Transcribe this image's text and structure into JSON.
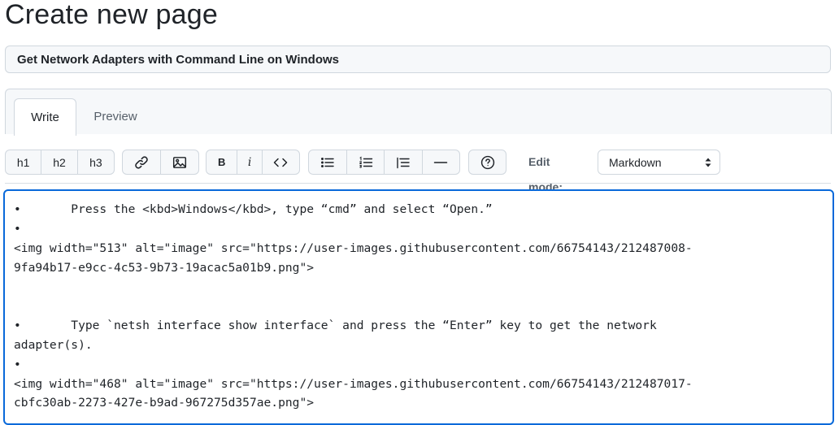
{
  "page": {
    "title": "Create new page"
  },
  "title_input": {
    "value": "Get Network Adapters with Command Line on Windows"
  },
  "tabs": [
    {
      "label": "Write",
      "active": true
    },
    {
      "label": "Preview",
      "active": false
    }
  ],
  "toolbar": {
    "h1_label": "h1",
    "h2_label": "h2",
    "h3_label": "h3",
    "link_icon": "link-icon",
    "image_icon": "image-icon",
    "bold_label": "B",
    "italic_label": "i",
    "code_icon": "code-icon",
    "unordered_list_icon": "unordered-list-icon",
    "ordered_list_icon": "ordered-list-icon",
    "task_list_icon": "task-list-icon",
    "horizontal_rule_icon": "horizontal-rule-icon",
    "help_icon": "question-icon",
    "edit_mode_label": "Edit mode:",
    "edit_mode_value": "Markdown"
  },
  "editor": {
    "content": "•       Press the <kbd>Windows</kbd>, type “cmd” and select “Open.”\n•\n<img width=\"513\" alt=\"image\" src=\"https://user-images.githubusercontent.com/66754143/212487008-\n9fa94b17-e9cc-4c53-9b73-19acac5a01b9.png\">\n\n\n•       Type `netsh interface show interface` and press the “Enter” key to get the network\nadapter(s).\n•\n<img width=\"468\" alt=\"image\" src=\"https://user-images.githubusercontent.com/66754143/212487017-\ncbfc30ab-2273-427e-b9ad-967275d357ae.png\">"
  },
  "colors": {
    "focus_border": "#0969da",
    "border": "#d0d7de",
    "header_bg": "#f6f8fa",
    "text": "#1f2328",
    "muted_text": "#57606a"
  }
}
